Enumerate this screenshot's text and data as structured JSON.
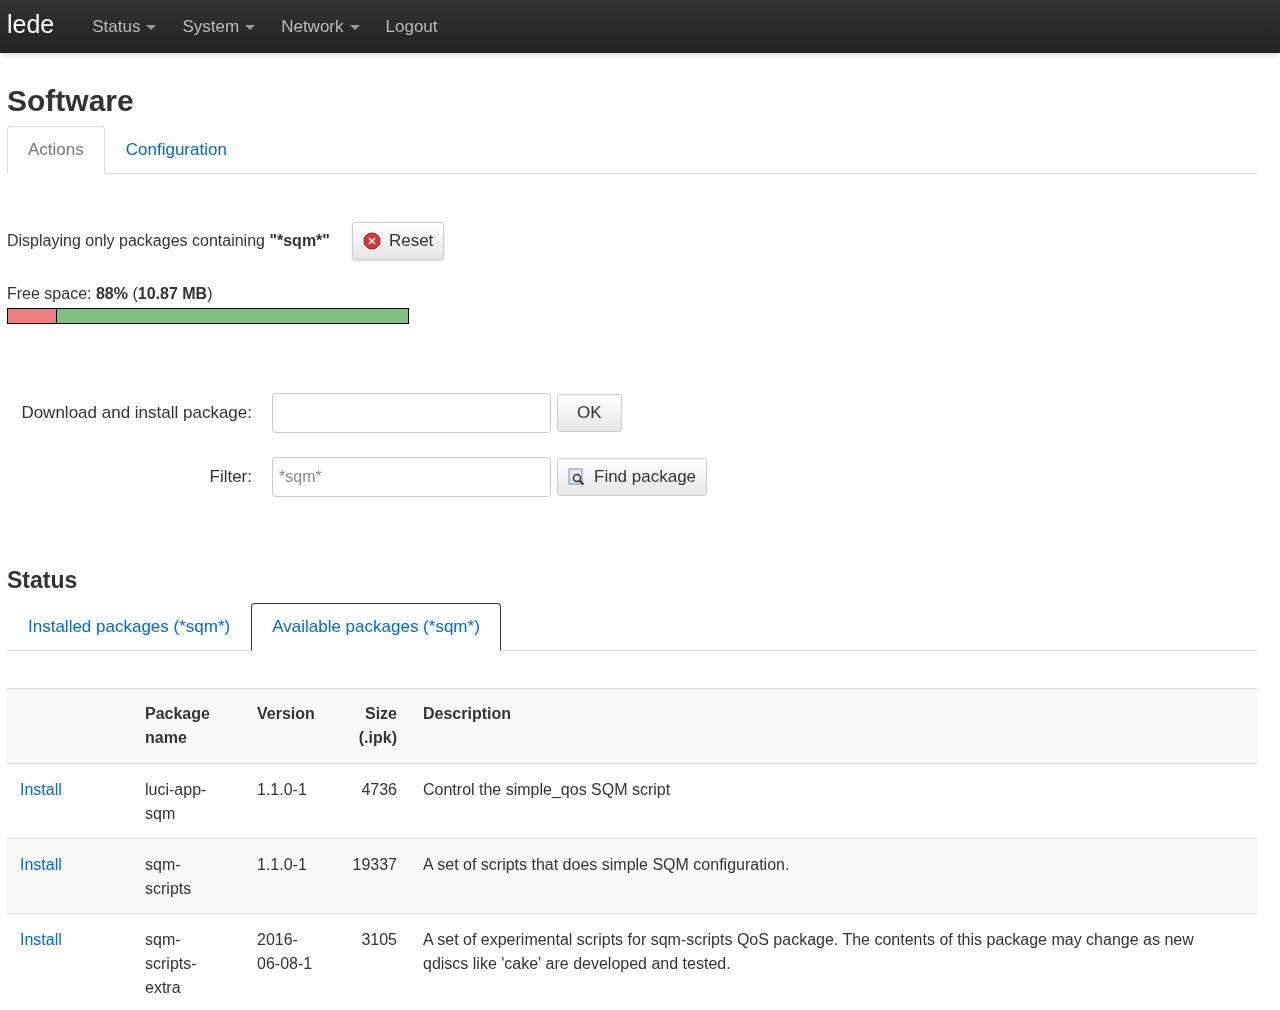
{
  "navbar": {
    "brand": "lede",
    "menu": [
      {
        "label": "Status",
        "dropdown": true
      },
      {
        "label": "System",
        "dropdown": true
      },
      {
        "label": "Network",
        "dropdown": true
      },
      {
        "label": "Logout",
        "dropdown": false
      }
    ]
  },
  "page_title": "Software",
  "tabs": [
    {
      "label": "Actions",
      "selected": true
    },
    {
      "label": "Configuration",
      "selected": false
    }
  ],
  "filter_notice": {
    "text": "Displaying only packages containing",
    "filter": "\"*sqm*\"",
    "reset_button": "Reset"
  },
  "free_space": {
    "text": "Free space: **88%** (**10.87 MB**)",
    "level": 0.88
  },
  "install_form": {
    "label": "Download and install package:",
    "button": "OK"
  },
  "filter_form": {
    "label": "Filter:",
    "value": "*sqm*",
    "button": "Find package"
  },
  "status_title": "Status",
  "status_tabs": [
    {
      "label": "Installed packages (*sqm*)",
      "selected": false
    },
    {
      "label": "Available packages (*sqm*)",
      "selected": true
    }
  ],
  "table": {
    "columns": [
      "",
      "Package name",
      "Version",
      "Size (.ipk)",
      "Description"
    ],
    "rows": [
      {
        "action": "Install",
        "name": "luci-app-sqm",
        "version": "1.1.0-1",
        "size": "4736",
        "description": "Control the simple_qos SQM script"
      },
      {
        "action": "Install",
        "name": "sqm-scripts",
        "version": "1.1.0-1",
        "size": "19337",
        "description": "A set of scripts that does simple SQM configuration."
      },
      {
        "action": "Install",
        "name": "sqm-scripts-extra",
        "version": "2016-06-08-1",
        "size": "3105",
        "description": "A set of experimental scripts for sqm-scripts QoS package. The contents of this package may change as new qdiscs like 'cake' are developed and tested."
      }
    ]
  }
}
